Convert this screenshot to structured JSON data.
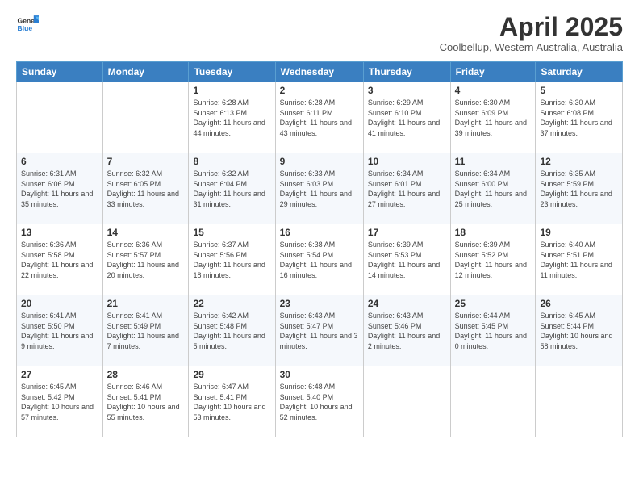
{
  "logo": {
    "line1": "General",
    "line2": "Blue"
  },
  "title": "April 2025",
  "location": "Coolbellup, Western Australia, Australia",
  "days_of_week": [
    "Sunday",
    "Monday",
    "Tuesday",
    "Wednesday",
    "Thursday",
    "Friday",
    "Saturday"
  ],
  "weeks": [
    [
      {
        "day": "",
        "info": ""
      },
      {
        "day": "",
        "info": ""
      },
      {
        "day": "1",
        "info": "Sunrise: 6:28 AM\nSunset: 6:13 PM\nDaylight: 11 hours and 44 minutes."
      },
      {
        "day": "2",
        "info": "Sunrise: 6:28 AM\nSunset: 6:11 PM\nDaylight: 11 hours and 43 minutes."
      },
      {
        "day": "3",
        "info": "Sunrise: 6:29 AM\nSunset: 6:10 PM\nDaylight: 11 hours and 41 minutes."
      },
      {
        "day": "4",
        "info": "Sunrise: 6:30 AM\nSunset: 6:09 PM\nDaylight: 11 hours and 39 minutes."
      },
      {
        "day": "5",
        "info": "Sunrise: 6:30 AM\nSunset: 6:08 PM\nDaylight: 11 hours and 37 minutes."
      }
    ],
    [
      {
        "day": "6",
        "info": "Sunrise: 6:31 AM\nSunset: 6:06 PM\nDaylight: 11 hours and 35 minutes."
      },
      {
        "day": "7",
        "info": "Sunrise: 6:32 AM\nSunset: 6:05 PM\nDaylight: 11 hours and 33 minutes."
      },
      {
        "day": "8",
        "info": "Sunrise: 6:32 AM\nSunset: 6:04 PM\nDaylight: 11 hours and 31 minutes."
      },
      {
        "day": "9",
        "info": "Sunrise: 6:33 AM\nSunset: 6:03 PM\nDaylight: 11 hours and 29 minutes."
      },
      {
        "day": "10",
        "info": "Sunrise: 6:34 AM\nSunset: 6:01 PM\nDaylight: 11 hours and 27 minutes."
      },
      {
        "day": "11",
        "info": "Sunrise: 6:34 AM\nSunset: 6:00 PM\nDaylight: 11 hours and 25 minutes."
      },
      {
        "day": "12",
        "info": "Sunrise: 6:35 AM\nSunset: 5:59 PM\nDaylight: 11 hours and 23 minutes."
      }
    ],
    [
      {
        "day": "13",
        "info": "Sunrise: 6:36 AM\nSunset: 5:58 PM\nDaylight: 11 hours and 22 minutes."
      },
      {
        "day": "14",
        "info": "Sunrise: 6:36 AM\nSunset: 5:57 PM\nDaylight: 11 hours and 20 minutes."
      },
      {
        "day": "15",
        "info": "Sunrise: 6:37 AM\nSunset: 5:56 PM\nDaylight: 11 hours and 18 minutes."
      },
      {
        "day": "16",
        "info": "Sunrise: 6:38 AM\nSunset: 5:54 PM\nDaylight: 11 hours and 16 minutes."
      },
      {
        "day": "17",
        "info": "Sunrise: 6:39 AM\nSunset: 5:53 PM\nDaylight: 11 hours and 14 minutes."
      },
      {
        "day": "18",
        "info": "Sunrise: 6:39 AM\nSunset: 5:52 PM\nDaylight: 11 hours and 12 minutes."
      },
      {
        "day": "19",
        "info": "Sunrise: 6:40 AM\nSunset: 5:51 PM\nDaylight: 11 hours and 11 minutes."
      }
    ],
    [
      {
        "day": "20",
        "info": "Sunrise: 6:41 AM\nSunset: 5:50 PM\nDaylight: 11 hours and 9 minutes."
      },
      {
        "day": "21",
        "info": "Sunrise: 6:41 AM\nSunset: 5:49 PM\nDaylight: 11 hours and 7 minutes."
      },
      {
        "day": "22",
        "info": "Sunrise: 6:42 AM\nSunset: 5:48 PM\nDaylight: 11 hours and 5 minutes."
      },
      {
        "day": "23",
        "info": "Sunrise: 6:43 AM\nSunset: 5:47 PM\nDaylight: 11 hours and 3 minutes."
      },
      {
        "day": "24",
        "info": "Sunrise: 6:43 AM\nSunset: 5:46 PM\nDaylight: 11 hours and 2 minutes."
      },
      {
        "day": "25",
        "info": "Sunrise: 6:44 AM\nSunset: 5:45 PM\nDaylight: 11 hours and 0 minutes."
      },
      {
        "day": "26",
        "info": "Sunrise: 6:45 AM\nSunset: 5:44 PM\nDaylight: 10 hours and 58 minutes."
      }
    ],
    [
      {
        "day": "27",
        "info": "Sunrise: 6:45 AM\nSunset: 5:42 PM\nDaylight: 10 hours and 57 minutes."
      },
      {
        "day": "28",
        "info": "Sunrise: 6:46 AM\nSunset: 5:41 PM\nDaylight: 10 hours and 55 minutes."
      },
      {
        "day": "29",
        "info": "Sunrise: 6:47 AM\nSunset: 5:41 PM\nDaylight: 10 hours and 53 minutes."
      },
      {
        "day": "30",
        "info": "Sunrise: 6:48 AM\nSunset: 5:40 PM\nDaylight: 10 hours and 52 minutes."
      },
      {
        "day": "",
        "info": ""
      },
      {
        "day": "",
        "info": ""
      },
      {
        "day": "",
        "info": ""
      }
    ]
  ]
}
